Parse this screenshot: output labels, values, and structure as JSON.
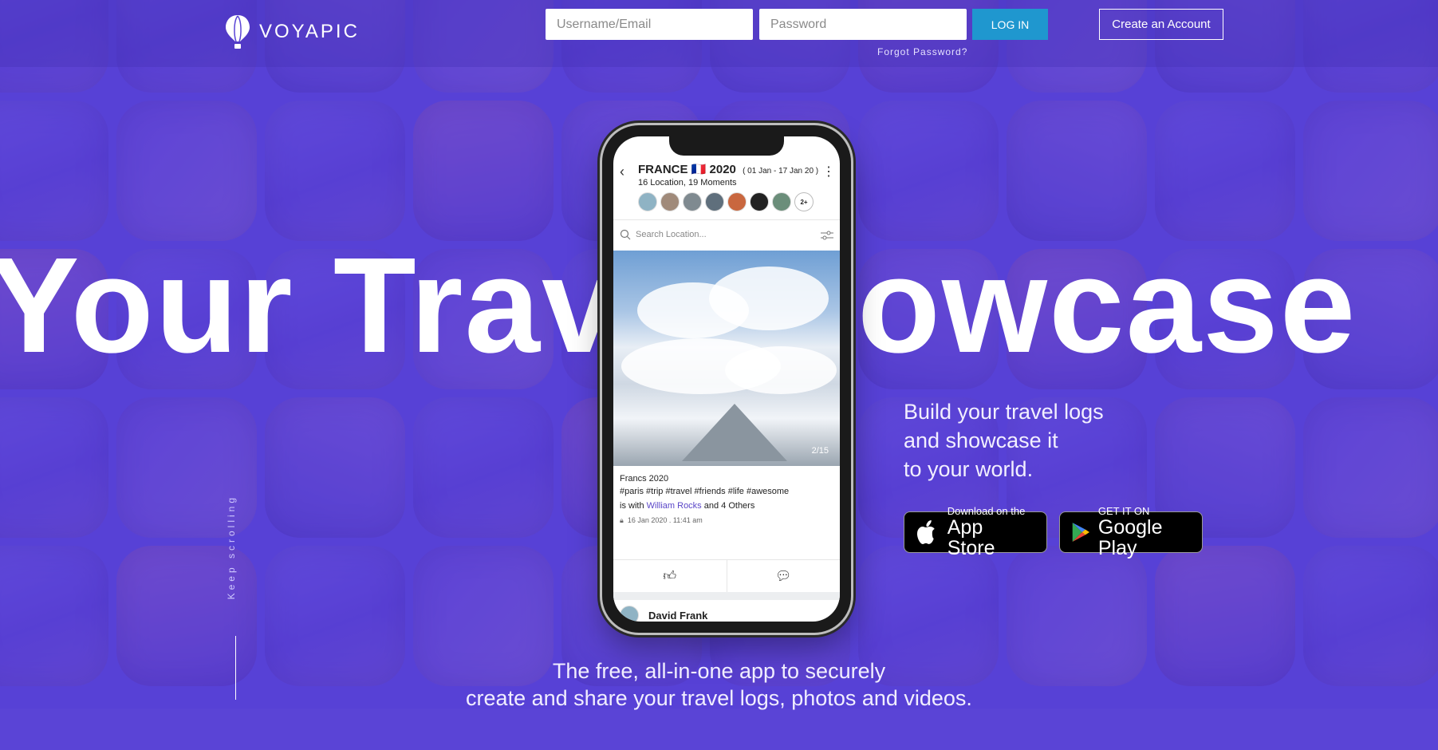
{
  "brand": {
    "name": "VOYAPIC"
  },
  "login": {
    "username_placeholder": "Username/Email",
    "password_placeholder": "Password",
    "login_label": "LOG IN",
    "forgot_label": "Forgot Password?",
    "create_label": "Create an Account"
  },
  "hero": {
    "left_text": "Your Trave",
    "right_text": "owcase",
    "tagline_lines": [
      "Build your travel logs",
      "and showcase it",
      "to your world."
    ],
    "bottom_lines": [
      "The free, all-in-one app to securely",
      "create and share your travel logs, photos and videos."
    ],
    "scroll_hint": "Keep scrolling"
  },
  "stores": {
    "apple_small": "Download on the",
    "apple_big": "App Store",
    "google_small": "GET IT ON",
    "google_big": "Google Play"
  },
  "phone": {
    "trip_title": "FRANCE",
    "trip_flag": "🇫🇷",
    "trip_year": "2020",
    "trip_dates": "( 01 Jan - 17 Jan 20 )",
    "moments": "16 Location, 19 Moments",
    "avatars_more": "2+",
    "search_placeholder": "Search Location...",
    "photo_counter": "2/15",
    "post_title": "Francs 2020",
    "post_tags": "#paris #trip #travel #friends #life #awesome",
    "with_prefix": "is with ",
    "with_name": "William Rocks",
    "with_suffix": " and 4 Others",
    "post_date": "16 Jan 2020",
    "post_time": "11:41 am",
    "next_user": "David Frank"
  },
  "colors": {
    "accent": "#1f97cf",
    "background": "#5a44d6",
    "link": "#5a46c8"
  }
}
